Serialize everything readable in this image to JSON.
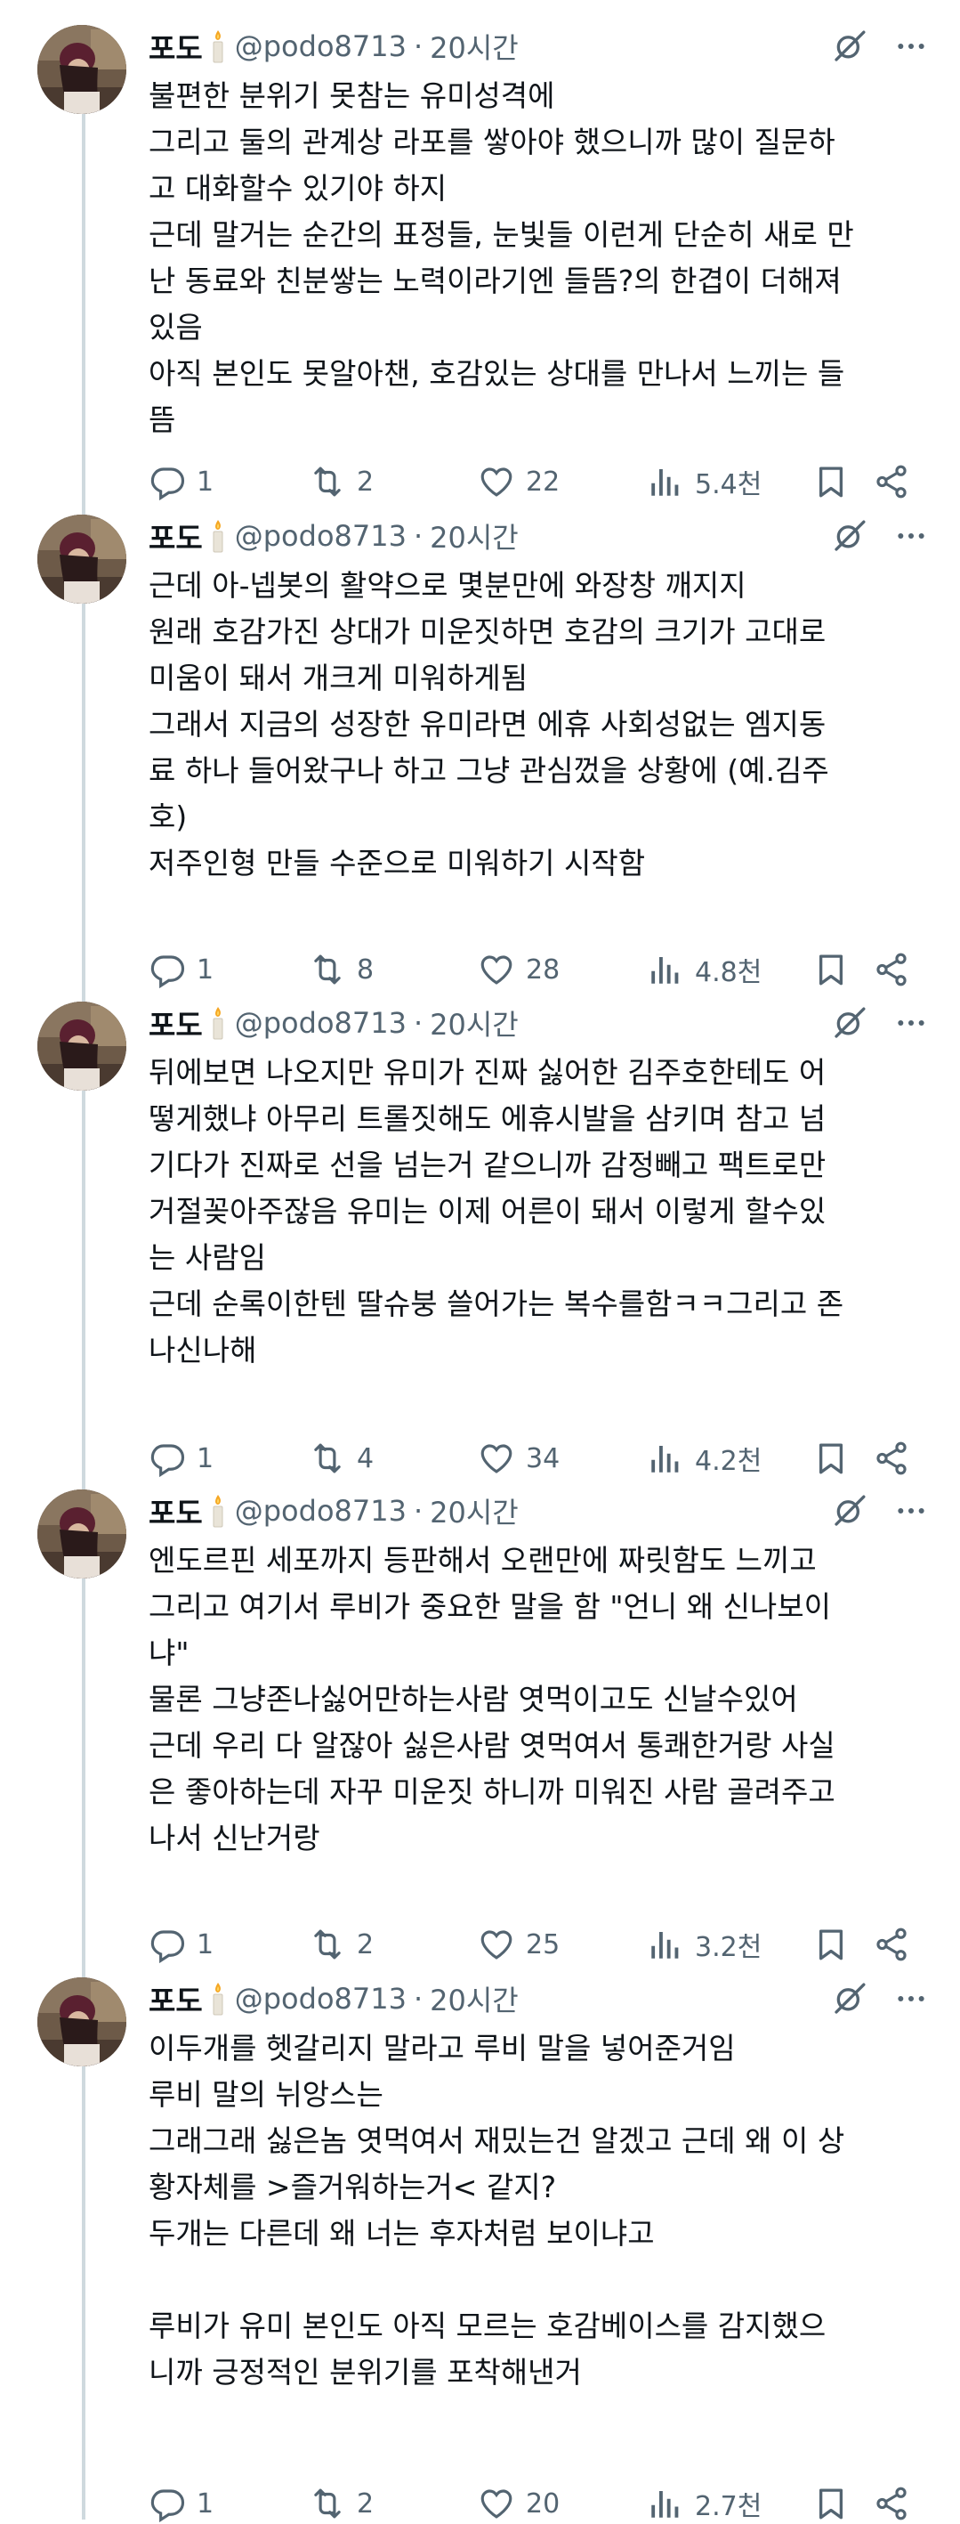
{
  "author": {
    "name": "포도",
    "handle": "@podo8713",
    "time": "20시간"
  },
  "tweets": [
    {
      "text": "불편한 분위기 못참는 유미성격에\n그리고 둘의 관계상 라포를 쌓아야 했으니까 많이 질문하\n고 대화할수 있기야 하지\n근데 말거는 순간의 표정들, 눈빛들 이런게 단순히 새로 만\n난 동료와 친분쌓는 노력이라기엔 들뜸?의 한겹이 더해져\n있음\n아직 본인도 못알아챈, 호감있는 상대를 만나서 느끼는 들\n뜸",
      "replies": "1",
      "reposts": "2",
      "likes": "22",
      "views": "5.4천"
    },
    {
      "text": "근데 아-넵봇의 활약으로 몇분만에 와장창 깨지지\n원래 호감가진 상대가 미운짓하면 호감의 크기가 고대로\n미움이 돼서 개크게 미워하게됨\n그래서 지금의 성장한 유미라면 에휴 사회성없는 엠지동\n료 하나 들어왔구나 하고 그냥 관심껐을 상황에 (예.김주\n호)\n저주인형 만들 수준으로 미워하기 시작함",
      "replies": "1",
      "reposts": "8",
      "likes": "28",
      "views": "4.8천"
    },
    {
      "text": "뒤에보면 나오지만 유미가 진짜 싫어한 김주호한테도 어\n떻게했냐 아무리 트롤짓해도 에휴시발을 삼키며 참고 넘\n기다가 진짜로 선을 넘는거 같으니까 감정빼고 팩트로만\n거절꽂아주잖음 유미는 이제 어른이 돼서 이렇게 할수있\n는 사람임\n근데 순록이한텐 딸슈붕 쓸어가는 복수를함ㅋㅋ그리고 존\n나신나해",
      "replies": "1",
      "reposts": "4",
      "likes": "34",
      "views": "4.2천"
    },
    {
      "text": "엔도르핀 세포까지 등판해서 오랜만에 짜릿함도 느끼고\n그리고 여기서 루비가 중요한 말을 함 \"언니 왜 신나보이\n냐\"\n물론 그냥존나싫어만하는사람 엿먹이고도 신날수있어\n근데 우리 다 알잖아 싫은사람 엿먹여서 통쾌한거랑 사실\n은 좋아하는데 자꾸 미운짓 하니까 미워진 사람 골려주고\n나서 신난거랑",
      "replies": "1",
      "reposts": "2",
      "likes": "25",
      "views": "3.2천"
    },
    {
      "text": "이두개를 헷갈리지 말라고 루비 말을 넣어준거임\n루비 말의 뉘앙스는\n그래그래 싫은놈 엿먹여서 재밌는건 알겠고 근데 왜 이 상\n황자체를 >즐거워하는거< 같지?\n두개는 다른데 왜 너는 후자처럼 보이냐고\n\n루비가 유미 본인도 아직 모르는 호감베이스를 감지했으\n니까 긍정적인 분위기를 포착해낸거",
      "replies": "1",
      "reposts": "2",
      "likes": "20",
      "views": "2.7천"
    }
  ],
  "colors": {
    "text": "#0f1419",
    "muted": "#536471",
    "line": "#cfd9de",
    "background": "#ffffff"
  }
}
